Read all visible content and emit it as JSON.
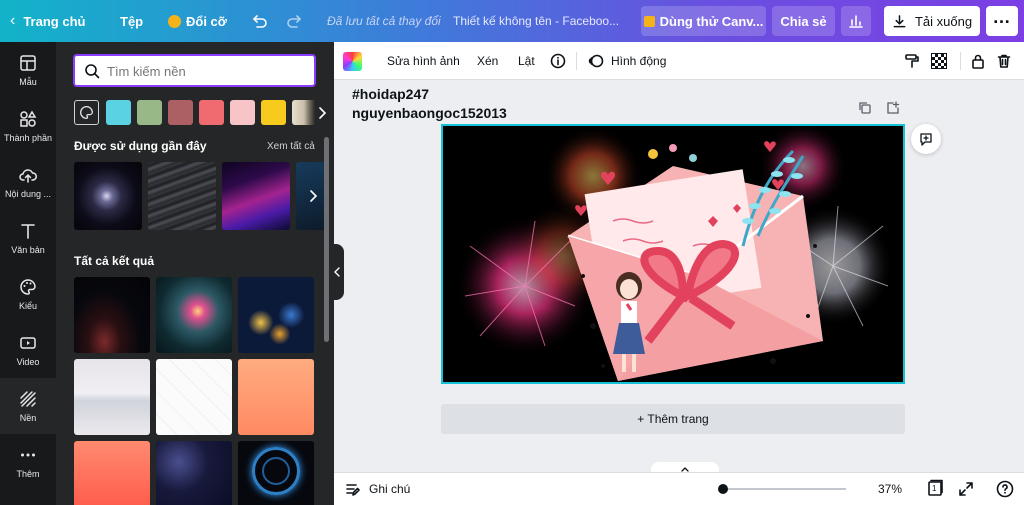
{
  "topbar": {
    "home_label": "Trang chủ",
    "file_label": "Tệp",
    "resize_label": "Đổi cỡ",
    "saved_status": "Đã lưu tất cả thay đổi",
    "doc_title": "Thiết kế không tên - Facebоо...",
    "try_pro_label": "Dùng thử Canv...",
    "share_label": "Chia sẻ",
    "download_label": "Tải xuống"
  },
  "rail": {
    "items": [
      {
        "label": "Mẫu",
        "icon": "layout-icon"
      },
      {
        "label": "Thành phần",
        "icon": "shapes-icon"
      },
      {
        "label": "Nội dung ...",
        "icon": "upload-cloud-icon"
      },
      {
        "label": "Văn bản",
        "icon": "text-icon"
      },
      {
        "label": "Kiểu",
        "icon": "palette-icon"
      },
      {
        "label": "Video",
        "icon": "video-icon"
      },
      {
        "label": "Nền",
        "icon": "background-icon"
      },
      {
        "label": "Thêm",
        "icon": "more-icon"
      }
    ]
  },
  "panel": {
    "search_placeholder": "Tìm kiếm nền",
    "swatch_colors": [
      "#5ad2e4",
      "#98b987",
      "#ad6064",
      "#f06b6f",
      "#f7c4c8",
      "#f6cb1e"
    ],
    "recent_heading": "Được sử dụng gần đây",
    "see_all_label": "Xem tất cả",
    "all_results_heading": "Tất cả kết quả"
  },
  "toolbar": {
    "edit_image_label": "Sửa hình ảnh",
    "crop_label": "Xén",
    "flip_label": "Lật",
    "animate_label": "Hình động"
  },
  "page": {
    "caption_line1": "#hoidap247",
    "caption_line2": "nguyenbaongoc152013",
    "add_page_label": "+ Thêm trang"
  },
  "bottombar": {
    "notes_label": "Ghi chú",
    "zoom_level": "37%",
    "page_count": "1"
  },
  "colors": {
    "accent": "#8b3dff",
    "selection": "#14c1d6",
    "rail_bg": "#18191b",
    "panel_bg": "#252627"
  }
}
